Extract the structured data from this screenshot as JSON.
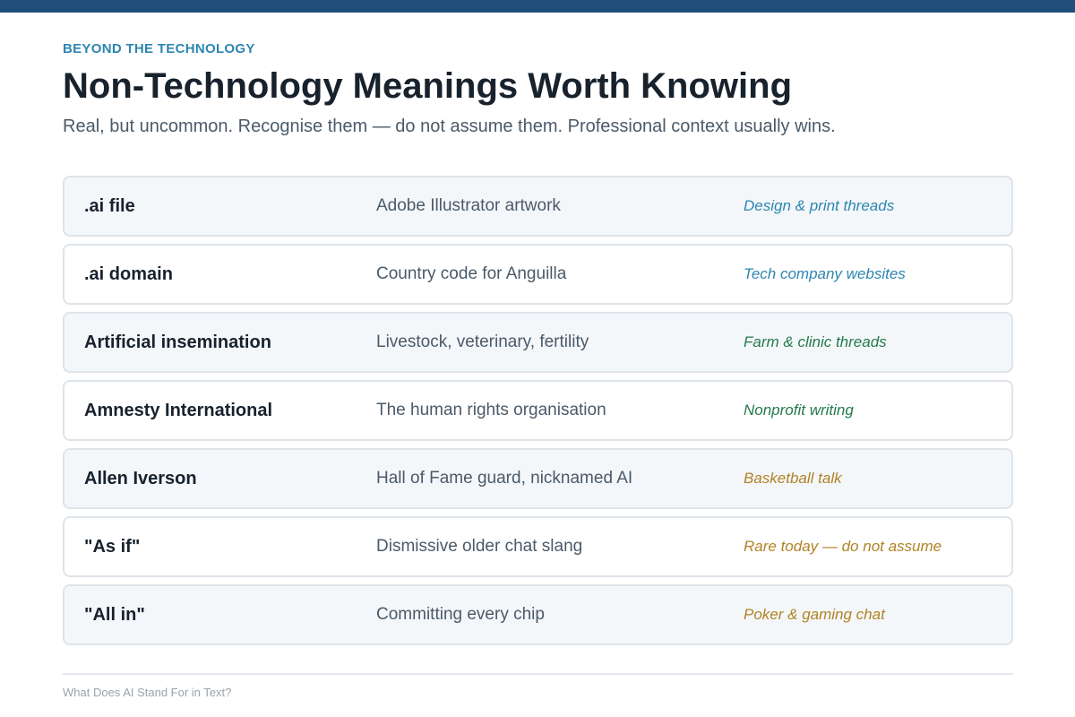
{
  "eyebrow": "BEYOND THE TECHNOLOGY",
  "title": "Non-Technology Meanings Worth Knowing",
  "subtitle": "Real, but uncommon. Recognise them — do not assume them. Professional context usually wins.",
  "colors": {
    "top_bar": "#1f4e7a",
    "eyebrow": "#2e86b0",
    "context_blue": "#2e86b0",
    "context_green": "#237a4b",
    "context_gold": "#b08325"
  },
  "rows": [
    {
      "term": ".ai file",
      "meaning": "Adobe Illustrator artwork",
      "context": "Design & print threads",
      "context_color": "#2e86b0"
    },
    {
      "term": ".ai domain",
      "meaning": "Country code for Anguilla",
      "context": "Tech company websites",
      "context_color": "#2e86b0"
    },
    {
      "term": "Artificial insemination",
      "meaning": "Livestock, veterinary, fertility",
      "context": "Farm & clinic threads",
      "context_color": "#237a4b"
    },
    {
      "term": "Amnesty International",
      "meaning": "The human rights organisation",
      "context": "Nonprofit writing",
      "context_color": "#237a4b"
    },
    {
      "term": "Allen Iverson",
      "meaning": "Hall of Fame guard, nicknamed AI",
      "context": "Basketball talk",
      "context_color": "#b08325"
    },
    {
      "term": "\"As if\"",
      "meaning": "Dismissive older chat slang",
      "context": "Rare today — do not assume",
      "context_color": "#b08325"
    },
    {
      "term": "\"All in\"",
      "meaning": "Committing every chip",
      "context": "Poker & gaming chat",
      "context_color": "#b08325"
    }
  ],
  "footer": "What Does AI Stand For in Text?"
}
